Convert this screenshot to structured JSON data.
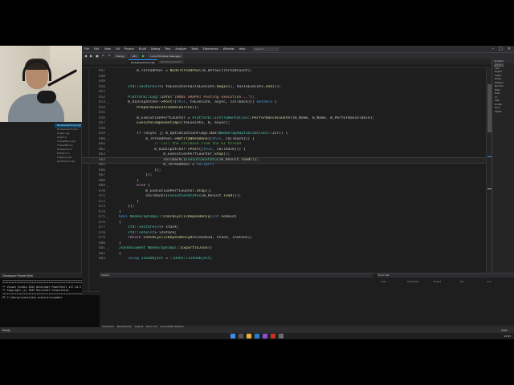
{
  "menu": {
    "items": [
      "File",
      "Edit",
      "View",
      "Git",
      "Project",
      "Build",
      "Debug",
      "Test",
      "Analyze",
      "Tools",
      "Extensions",
      "Window",
      "Help"
    ],
    "search_placeholder": "Search"
  },
  "toolbar": {
    "config": "Debug",
    "platform": "x64",
    "target": "Local Windows Debugger"
  },
  "tabs": [
    {
      "label": "NodeGraphImpl.cpp",
      "active": true
    },
    {
      "label": "NodeGraphImpl.h",
      "active": false
    }
  ],
  "code_lines": [
    {
      "n": "447",
      "fold": "",
      "html": "        <span class=\"v\">m_ThreadPool</span> = <span class=\"f\">NodeThreadPool</span>(<span class=\"v\">m_DefaultThreadCount</span>);"
    },
    {
      "n": "448",
      "fold": "",
      "html": ""
    },
    {
      "n": "449",
      "fold": "",
      "html": ""
    },
    {
      "n": "450",
      "fold": "",
      "html": "    <span class=\"t\">std</span>::<span class=\"t\">vector</span>&lt;<span class=\"k\">int</span>&gt; <span class=\"v\">toExecute</span>(<span class=\"v\">hasToExecute</span>.<span class=\"f\">begin</span>(), <span class=\"v\">hasToExecute</span>.<span class=\"f\">end</span>());"
    },
    {
      "n": "451",
      "fold": "",
      "html": ""
    },
    {
      "n": "452",
      "fold": "",
      "html": "    <span class=\"t\">Platform</span>::<span class=\"t\">Log</span>::<span class=\"f\">Info</span>(<span class=\"s\">\"[NODE GRAPH] Posting execution...\"</span>);"
    },
    {
      "n": "453",
      "fold": "⌄",
      "html": "    <span class=\"v\">m_UIDispatcher</span>-&gt;<span class=\"f\">Post</span>([<span class=\"k\">this</span>, <span class=\"v\">toExecute</span>, <span class=\"v\">async</span>, <span class=\"v\">callback</span>]() <span class=\"k\">mutable</span> {"
    },
    {
      "n": "454",
      "fold": "",
      "html": "        <span class=\"f\">PrepareExecutionResources</span>();"
    },
    {
      "n": "455",
      "fold": "",
      "html": ""
    },
    {
      "n": "456",
      "fold": "",
      "html": "        <span class=\"v\">m_ExecutionPerfCounter</span> = <span class=\"t\">Platform</span>::<span class=\"t\">Instrumentation</span>::<span class=\"f\">PerformanceCounter</span>(<span class=\"v\">m_Name</span>, <span class=\"v\">m_Name</span>, <span class=\"v\">m_PerformanceTable</span>);"
    },
    {
      "n": "457",
      "fold": "",
      "html": "        <span class=\"f\">ExecuteComponentImpl</span>(<span class=\"v\">toExecute</span>, <span class=\"n\">0</span>, <span class=\"v\">async</span>);"
    },
    {
      "n": "458",
      "fold": "",
      "html": ""
    },
    {
      "n": "459",
      "fold": "⌄",
      "html": "        <span class=\"kc\">if</span> (<span class=\"v\">async</span> || <span class=\"v\">m_OptimizationFlags</span>.<span class=\"f\">Has</span>(<span class=\"t\">NodeGraphOptimizations</span>::<span class=\"e\">JIT</span>)) {"
    },
    {
      "n": "460",
      "fold": "⌄",
      "html": "            <span class=\"v\">m_ThreadPool</span>-&gt;<span class=\"f\">NotifyWhenDone</span>([<span class=\"k\">this</span>, <span class=\"v\">callback</span>]() {"
    },
    {
      "n": "461",
      "fold": "",
      "html": "                <span class=\"c\">// Call the callback from the UI thread</span>"
    },
    {
      "n": "462",
      "fold": "⌄",
      "html": "                <span class=\"v\">m_UIDispatcher</span>-&gt;<span class=\"f\">Post</span>([<span class=\"k\">this</span>, <span class=\"v\">callback</span>]() {"
    },
    {
      "n": "463",
      "fold": "",
      "html": "                    <span class=\"v\">m_ExecutionPerfCounter</span>.<span class=\"f\">Stop</span>();"
    },
    {
      "n": "464",
      "fold": "",
      "html": "                    <span class=\"v\">callback</span>((<span class=\"t\">ExecutionStatus</span>)<span class=\"v\">m_Result</span>.<span class=\"f\">load</span>());",
      "cur": true
    },
    {
      "n": "465",
      "fold": "",
      "html": "                    <span class=\"v\">m_ThreadPool</span> = <span class=\"k\">nullptr</span>;"
    },
    {
      "n": "466",
      "fold": "",
      "html": "                });"
    },
    {
      "n": "467",
      "fold": "",
      "html": "            });"
    },
    {
      "n": "468",
      "fold": "",
      "html": "        }"
    },
    {
      "n": "469",
      "fold": "⌄",
      "html": "        <span class=\"kc\">else</span> {"
    },
    {
      "n": "470",
      "fold": "",
      "html": "            <span class=\"v\">m_ExecutionPerfCounter</span>.<span class=\"f\">Stop</span>();"
    },
    {
      "n": "471",
      "fold": "",
      "html": "            <span class=\"v\">callback</span>((<span class=\"t\">ExecutionStatus</span>)<span class=\"v\">m_Result</span>.<span class=\"f\">load</span>());"
    },
    {
      "n": "472",
      "fold": "",
      "html": "        }"
    },
    {
      "n": "473",
      "fold": "",
      "html": "    });"
    },
    {
      "n": "474",
      "fold": "",
      "html": "}"
    },
    {
      "n": "475",
      "fold": "⌄",
      "html": "<span class=\"k\">bool</span> <span class=\"t\">NodeGraphImpl</span>::<span class=\"f\">CheckCyclicDependency</span>(<span class=\"k\">int</span> <span class=\"v\">nodeId</span>)"
    },
    {
      "n": "476",
      "fold": "",
      "html": "{"
    },
    {
      "n": "477",
      "fold": "",
      "html": "    <span class=\"t\">std</span>::<span class=\"t\">vector</span>&lt;<span class=\"k\">int</span>&gt; <span class=\"v\">stack</span>;"
    },
    {
      "n": "478",
      "fold": "",
      "html": "    <span class=\"t\">std</span>::<span class=\"t\">set</span>&lt;<span class=\"k\">int</span>&gt; <span class=\"v\">inStack</span>;"
    },
    {
      "n": "479",
      "fold": "",
      "html": "    <span class=\"kc\">return</span> <span class=\"f\">CheckCyclicDependencyDFS</span>(<span class=\"v\">nodeId</span>, <span class=\"v\">stack</span>, <span class=\"v\">inStack</span>);"
    },
    {
      "n": "480",
      "fold": "",
      "html": "}"
    },
    {
      "n": "481",
      "fold": "⌄",
      "html": "<span class=\"t\">JsonDocument</span> <span class=\"t\">NodeGraphImpl</span>::<span class=\"f\">ExportToJson</span>()"
    },
    {
      "n": "482",
      "fold": "",
      "html": "{"
    },
    {
      "n": "483",
      "fold": "",
      "html": "    <span class=\"k\">using</span> <span class=\"t\">JsonObject</span> = ::<span class=\"t\">Data</span>::<span class=\"t\">JsonObject</span>;"
    }
  ],
  "terminal": {
    "tab": "Developer PowerShell",
    "lines": [
      "**********************************************************",
      "** Visual Studio 2022 Developer PowerShell v17.14.9",
      "** Copyright (c) 2025 Microsoft Corporation",
      "**********************************************************",
      "PS C:\\dev\\projects\\bin-scale\\src\\nodes>"
    ]
  },
  "left_items": [
    "NodeGraphImpl.cpp",
    "NodeGraphImpl.h",
    "Graph.cpp",
    "Graph.h",
    "ThreadPool.cpp",
    "ThreadPool.h",
    "Dispatcher.h",
    "Platform.h",
    "Logging.cpp",
    "JsonExport.cpp"
  ],
  "right_panel": {
    "title": "Solution Explorer",
    "items": [
      "Solution",
      "Core",
      "Engine",
      "Graph",
      "Nodes",
      "Platform",
      "Runtime",
      "Tests",
      "Tools",
      "UI",
      "Utils",
      "Scripts",
      "Docs",
      "Assets"
    ]
  },
  "bottom": {
    "left_title": "Output",
    "right_title": "Error List",
    "columns": [
      "Code",
      "Description",
      "Project",
      "File",
      "Line"
    ],
    "tabs": [
      "Call Stack",
      "Breakpoints",
      "Output",
      "Error List",
      "Immediate Window"
    ]
  },
  "editor_status": {
    "zoom": "110 %",
    "issues": "No issues found",
    "position": "Ln: 464  Ch: 52",
    "encoding": "SPC",
    "eol": "CRLF"
  },
  "statusbar": {
    "ready": "Ready",
    "git": "main"
  },
  "taskbar": {
    "time": "12:41",
    "date": "2025-01-01"
  },
  "colors": {
    "accent": "#3794ff",
    "editor_bg": "#1e1e1e",
    "keyword": "#569cd6",
    "type": "#4ec9b0",
    "function": "#dcdcaa",
    "string": "#d69d85",
    "comment": "#57a64a"
  }
}
